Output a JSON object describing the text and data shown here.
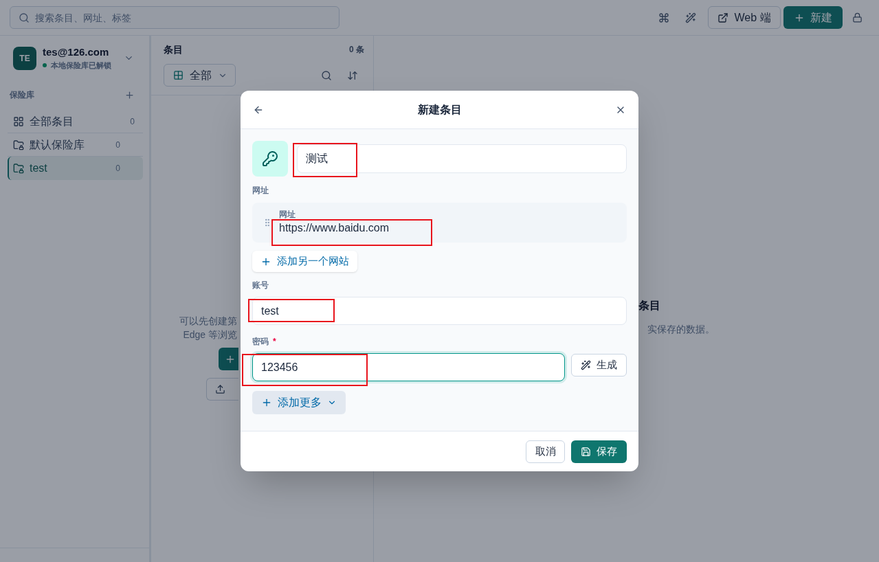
{
  "top_bar": {
    "search": {
      "placeholder": "搜索条目、网址、标签"
    },
    "web_button": "Web 端",
    "new_button": "新建"
  },
  "sidebar": {
    "account": {
      "initials": "TE",
      "email": "tes@126.com",
      "status": "本地保险库已解锁"
    },
    "section_title": "保险库",
    "items": [
      {
        "kind": "all",
        "label": "全部条目",
        "count": "0",
        "selected": false
      },
      {
        "kind": "vault",
        "label": "默认保险库",
        "count": "0",
        "selected": false
      },
      {
        "kind": "vault",
        "label": "test",
        "count": "0",
        "selected": true
      }
    ]
  },
  "list_panel": {
    "title": "条目",
    "count": "0 条",
    "filter": "全部",
    "empty_state": {
      "lines": [
        "可以先创建第",
        "Edge 等浏览"
      ]
    }
  },
  "detail_panel": {
    "empty_state": {
      "title": "条目",
      "description": "实保存的数据。"
    }
  },
  "dialog": {
    "title": "新建条目",
    "name_field": {
      "value": "测试",
      "highlighted": true
    },
    "fields": [
      {
        "kind": "url",
        "label": "网址",
        "inner_label": "网址",
        "value": "https://www.baidu.com",
        "focused": false,
        "highlighted": true,
        "add_button": "添加另一个网站"
      },
      {
        "kind": "text",
        "label": "账号",
        "value": "test",
        "focused": false,
        "highlighted": true
      },
      {
        "kind": "password",
        "label": "密码",
        "required_mark": "*",
        "value": "123456",
        "focused": true,
        "highlighted": true,
        "generate_button": "生成"
      }
    ],
    "add_more": "添加更多",
    "buttons": [
      {
        "kind": "secondary",
        "label": "取消"
      },
      {
        "kind": "primary",
        "label": "保存"
      }
    ]
  }
}
